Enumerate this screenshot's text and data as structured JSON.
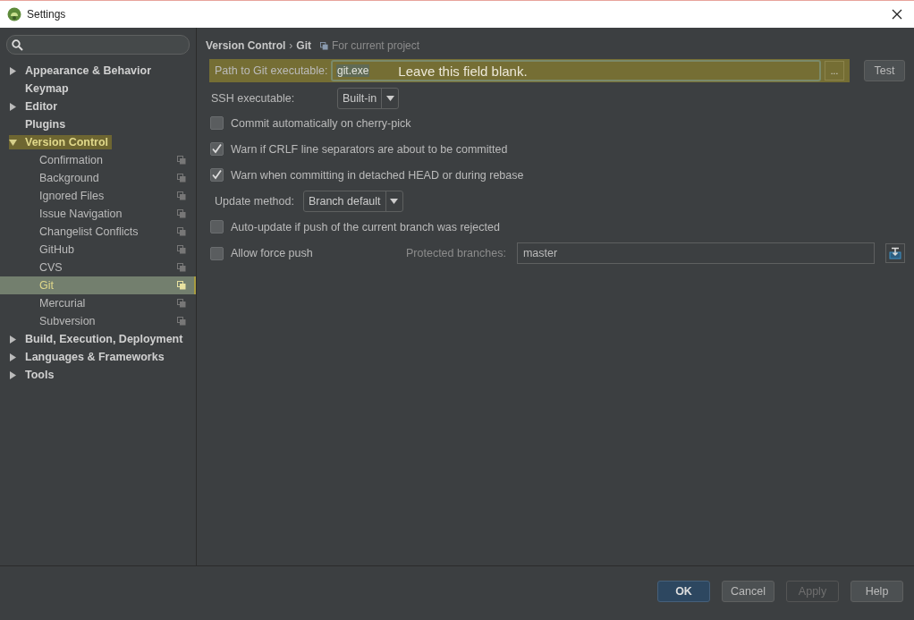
{
  "window": {
    "title": "Settings"
  },
  "sidebar": {
    "items": [
      {
        "label": "Appearance & Behavior",
        "kind": "group",
        "expanded": false,
        "highlighted": false
      },
      {
        "label": "Keymap",
        "kind": "page",
        "highlighted": false
      },
      {
        "label": "Editor",
        "kind": "group",
        "expanded": false,
        "highlighted": false
      },
      {
        "label": "Plugins",
        "kind": "page",
        "highlighted": false
      },
      {
        "label": "Version Control",
        "kind": "group",
        "expanded": true,
        "highlighted": true,
        "children": [
          {
            "label": "Confirmation",
            "selected": false
          },
          {
            "label": "Background",
            "selected": false
          },
          {
            "label": "Ignored Files",
            "selected": false
          },
          {
            "label": "Issue Navigation",
            "selected": false
          },
          {
            "label": "Changelist Conflicts",
            "selected": false
          },
          {
            "label": "GitHub",
            "selected": false
          },
          {
            "label": "CVS",
            "selected": false
          },
          {
            "label": "Git",
            "selected": true
          },
          {
            "label": "Mercurial",
            "selected": false
          },
          {
            "label": "Subversion",
            "selected": false
          }
        ]
      },
      {
        "label": "Build, Execution, Deployment",
        "kind": "group",
        "expanded": false,
        "highlighted": false
      },
      {
        "label": "Languages & Frameworks",
        "kind": "group",
        "expanded": false,
        "highlighted": false
      },
      {
        "label": "Tools",
        "kind": "group",
        "expanded": false,
        "highlighted": false
      }
    ]
  },
  "breadcrumb": {
    "parent": "Version Control",
    "separator": "›",
    "current": "Git",
    "scope": "For current project"
  },
  "git_path": {
    "label": "Path to Git executable:",
    "value": "git.exe",
    "highlighted": true,
    "annotation": "Leave this field blank.",
    "browse": "...",
    "test_button": "Test"
  },
  "ssh": {
    "label": "SSH executable:",
    "value": "Built-in"
  },
  "options": [
    {
      "kind": "checkbox",
      "label": "Commit automatically on cherry-pick",
      "checked": false
    },
    {
      "kind": "checkbox",
      "label": "Warn if CRLF line separators are about to be committed",
      "checked": true
    },
    {
      "kind": "checkbox",
      "label": "Warn when committing in detached HEAD or during rebase",
      "checked": true
    },
    {
      "kind": "dropdown",
      "label": "Update method:",
      "value": "Branch default"
    },
    {
      "kind": "checkbox",
      "label": "Auto-update if push of the current branch was rejected",
      "checked": false
    }
  ],
  "force_push": {
    "label": "Allow force push",
    "checked": false,
    "protected_label": "Protected branches:",
    "protected_value": "master"
  },
  "buttons": [
    {
      "label": "OK",
      "primary": true,
      "disabled": false
    },
    {
      "label": "Cancel",
      "primary": false,
      "disabled": false
    },
    {
      "label": "Apply",
      "primary": false,
      "disabled": true
    },
    {
      "label": "Help",
      "primary": false,
      "disabled": false
    }
  ]
}
